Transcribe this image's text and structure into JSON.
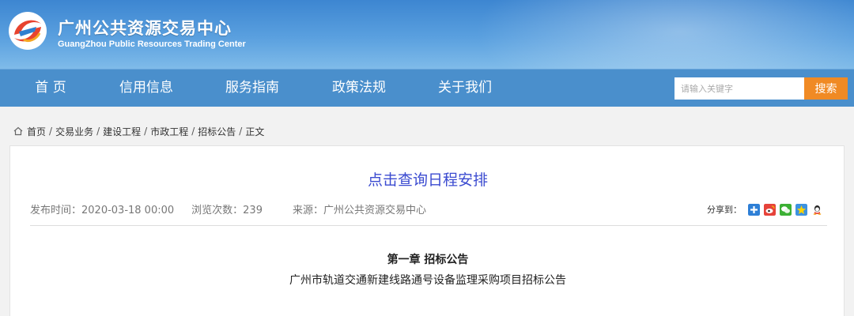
{
  "header": {
    "title": "广州公共资源交易中心",
    "subtitle": "GuangZhou Public Resources Trading Center"
  },
  "nav": {
    "items": [
      "首 页",
      "信用信息",
      "服务指南",
      "政策法规",
      "关于我们"
    ],
    "search_placeholder": "请输入关键字",
    "search_button": "搜索"
  },
  "breadcrumb": {
    "items": [
      "首页",
      "交易业务",
      "建设工程",
      "市政工程",
      "招标公告",
      "正文"
    ],
    "separator": "/"
  },
  "article": {
    "schedule_link": "点击查询日程安排",
    "publish_time": "发布时间：2020-03-18 00:00",
    "views": "浏览次数：239",
    "source": "来源：广州公共资源交易中心",
    "share_label": "分享到：",
    "share_icons": [
      "qzone-plus-icon",
      "weibo-icon",
      "wechat-icon",
      "qq-space-icon",
      "qq-icon"
    ],
    "chapter_title": "第一章 招标公告",
    "doc_title": "广州市轨道交通新建线路通号设备监理采购项目招标公告"
  },
  "colors": {
    "nav_bg": "#4a8fcc",
    "search_btn": "#f08a24",
    "link": "#3b4bd0"
  }
}
